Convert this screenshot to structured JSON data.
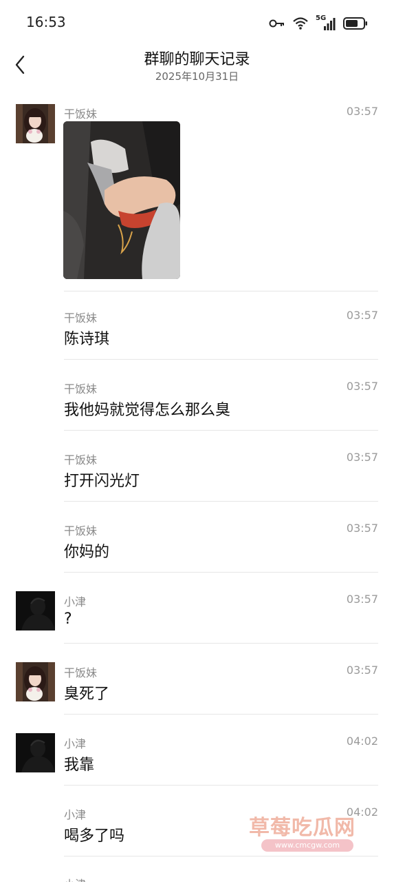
{
  "status_bar": {
    "time": "16:53",
    "network": "5G"
  },
  "header": {
    "title": "群聊的聊天记录",
    "date": "2025年10月31日"
  },
  "messages": [
    {
      "sender": "干饭妹",
      "time": "03:57",
      "type": "image"
    },
    {
      "sender": "干饭妹",
      "time": "03:57",
      "text": "陈诗琪"
    },
    {
      "sender": "干饭妹",
      "time": "03:57",
      "text": "我他妈就觉得怎么那么臭"
    },
    {
      "sender": "干饭妹",
      "time": "03:57",
      "text": "打开闪光灯"
    },
    {
      "sender": "干饭妹",
      "time": "03:57",
      "text": "你妈的"
    },
    {
      "sender": "小津",
      "time": "03:57",
      "text": "?"
    },
    {
      "sender": "干饭妹",
      "time": "03:57",
      "text": "臭死了"
    },
    {
      "sender": "小津",
      "time": "04:02",
      "text": "我靠"
    },
    {
      "sender": "小津",
      "time": "04:02",
      "text": "喝多了吗"
    },
    {
      "sender": "小津",
      "time": "",
      "text": ""
    }
  ],
  "watermark": {
    "title": "草莓吃瓜网",
    "url": "www.cmcgw.com"
  },
  "colors": {
    "accent_gray": "#8a8a8a",
    "divider": "#e6e6e6",
    "watermark": "#f1b9a9"
  }
}
